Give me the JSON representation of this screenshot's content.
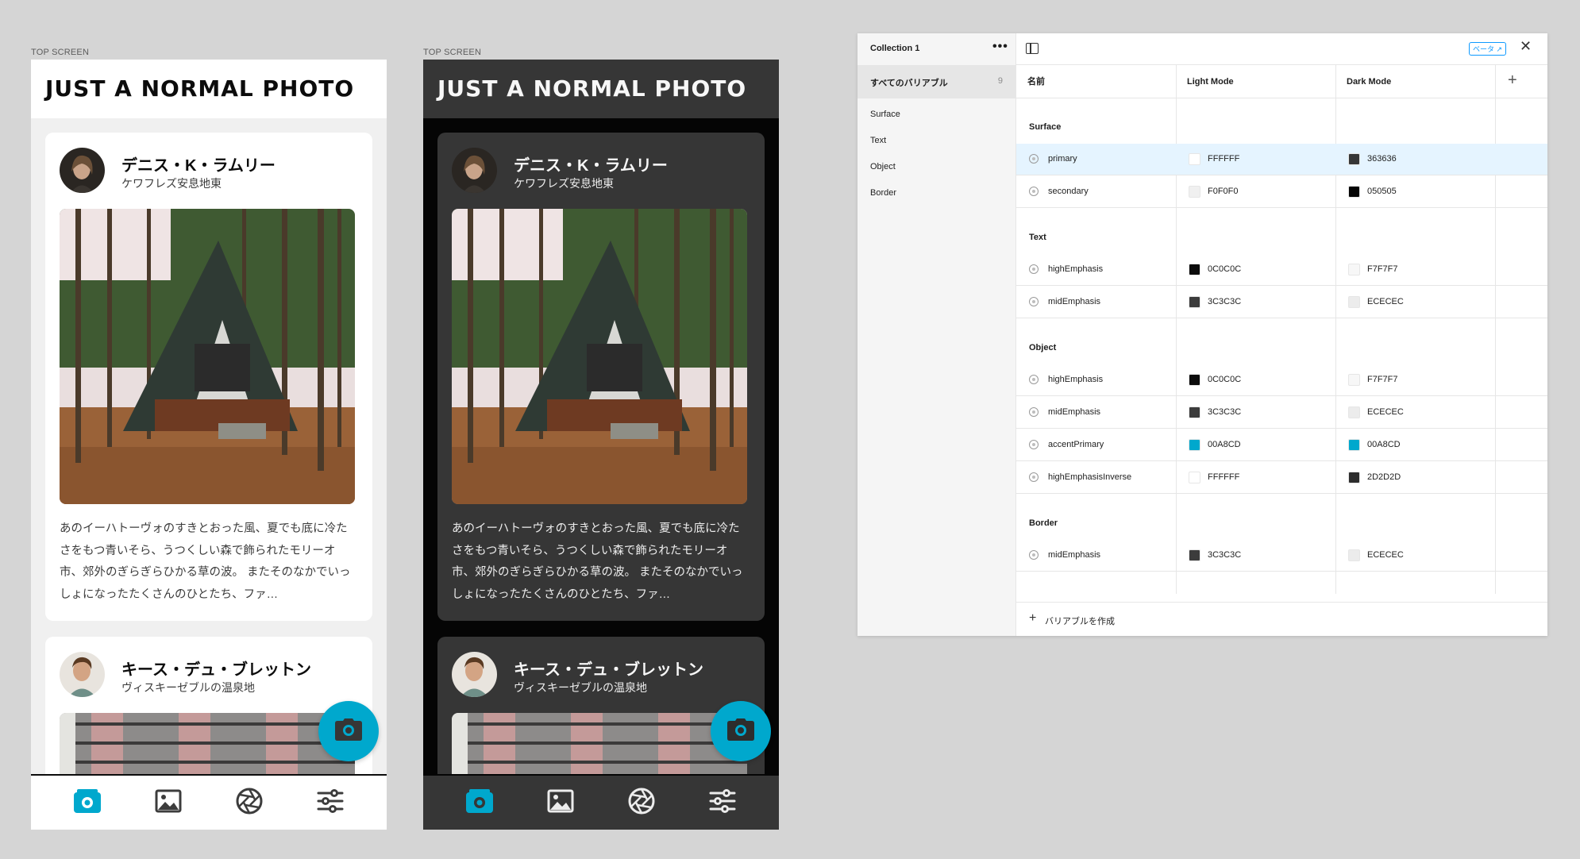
{
  "frames": {
    "light_label": "TOP SCREEN",
    "dark_label": "TOP SCREEN"
  },
  "app": {
    "logo": "JUST A NORMAL PHOTO",
    "posts": [
      {
        "author": "デニス・K・ラムリー",
        "location": "ケワフレズ安息地東",
        "description": "あのイーハトーヴォのすきとおった風、夏でも底に冷たさをもつ青いそら、うつくしい森で飾られたモリーオ市、郊外のぎらぎらひかる草の波。 またそのなかでいっしょになったたくさんのひとたち、ファ…"
      },
      {
        "author": "キース・デュ・ブレットン",
        "location": "ヴィスキーゼブルの温泉地"
      }
    ],
    "nav_icons": [
      "home-photo-icon",
      "image-icon",
      "aperture-icon",
      "settings-sliders-icon"
    ],
    "fab_icon": "camera-icon"
  },
  "colors": {
    "accent": "#00A8CD",
    "light_surface": "#FFFFFF",
    "light_surface_secondary": "#F0F0F0",
    "dark_surface": "#363636",
    "dark_surface_secondary": "#050505"
  },
  "panel": {
    "collection": "Collection 1",
    "more": "•••",
    "all_variables": "すべてのバリアブル",
    "all_count": "9",
    "groups_nav": [
      "Surface",
      "Text",
      "Object",
      "Border"
    ],
    "beta": "ベータ ↗",
    "close": "✕",
    "columns": {
      "name": "名前",
      "light": "Light Mode",
      "dark": "Dark Mode",
      "add": "+"
    },
    "groups": [
      {
        "name": "Surface",
        "rows": [
          {
            "name": "primary",
            "light": "FFFFFF",
            "dark": "363636"
          },
          {
            "name": "secondary",
            "light": "F0F0F0",
            "dark": "050505"
          }
        ]
      },
      {
        "name": "Text",
        "rows": [
          {
            "name": "highEmphasis",
            "light": "0C0C0C",
            "dark": "F7F7F7"
          },
          {
            "name": "midEmphasis",
            "light": "3C3C3C",
            "dark": "ECECEC"
          }
        ]
      },
      {
        "name": "Object",
        "rows": [
          {
            "name": "highEmphasis",
            "light": "0C0C0C",
            "dark": "F7F7F7"
          },
          {
            "name": "midEmphasis",
            "light": "3C3C3C",
            "dark": "ECECEC"
          },
          {
            "name": "accentPrimary",
            "light": "00A8CD",
            "dark": "00A8CD"
          },
          {
            "name": "highEmphasisInverse",
            "light": "FFFFFF",
            "dark": "2D2D2D"
          }
        ]
      },
      {
        "name": "Border",
        "rows": [
          {
            "name": "midEmphasis",
            "light": "3C3C3C",
            "dark": "ECECEC"
          }
        ]
      }
    ],
    "create_label": "バリアブルを作成",
    "create_plus": "+"
  }
}
